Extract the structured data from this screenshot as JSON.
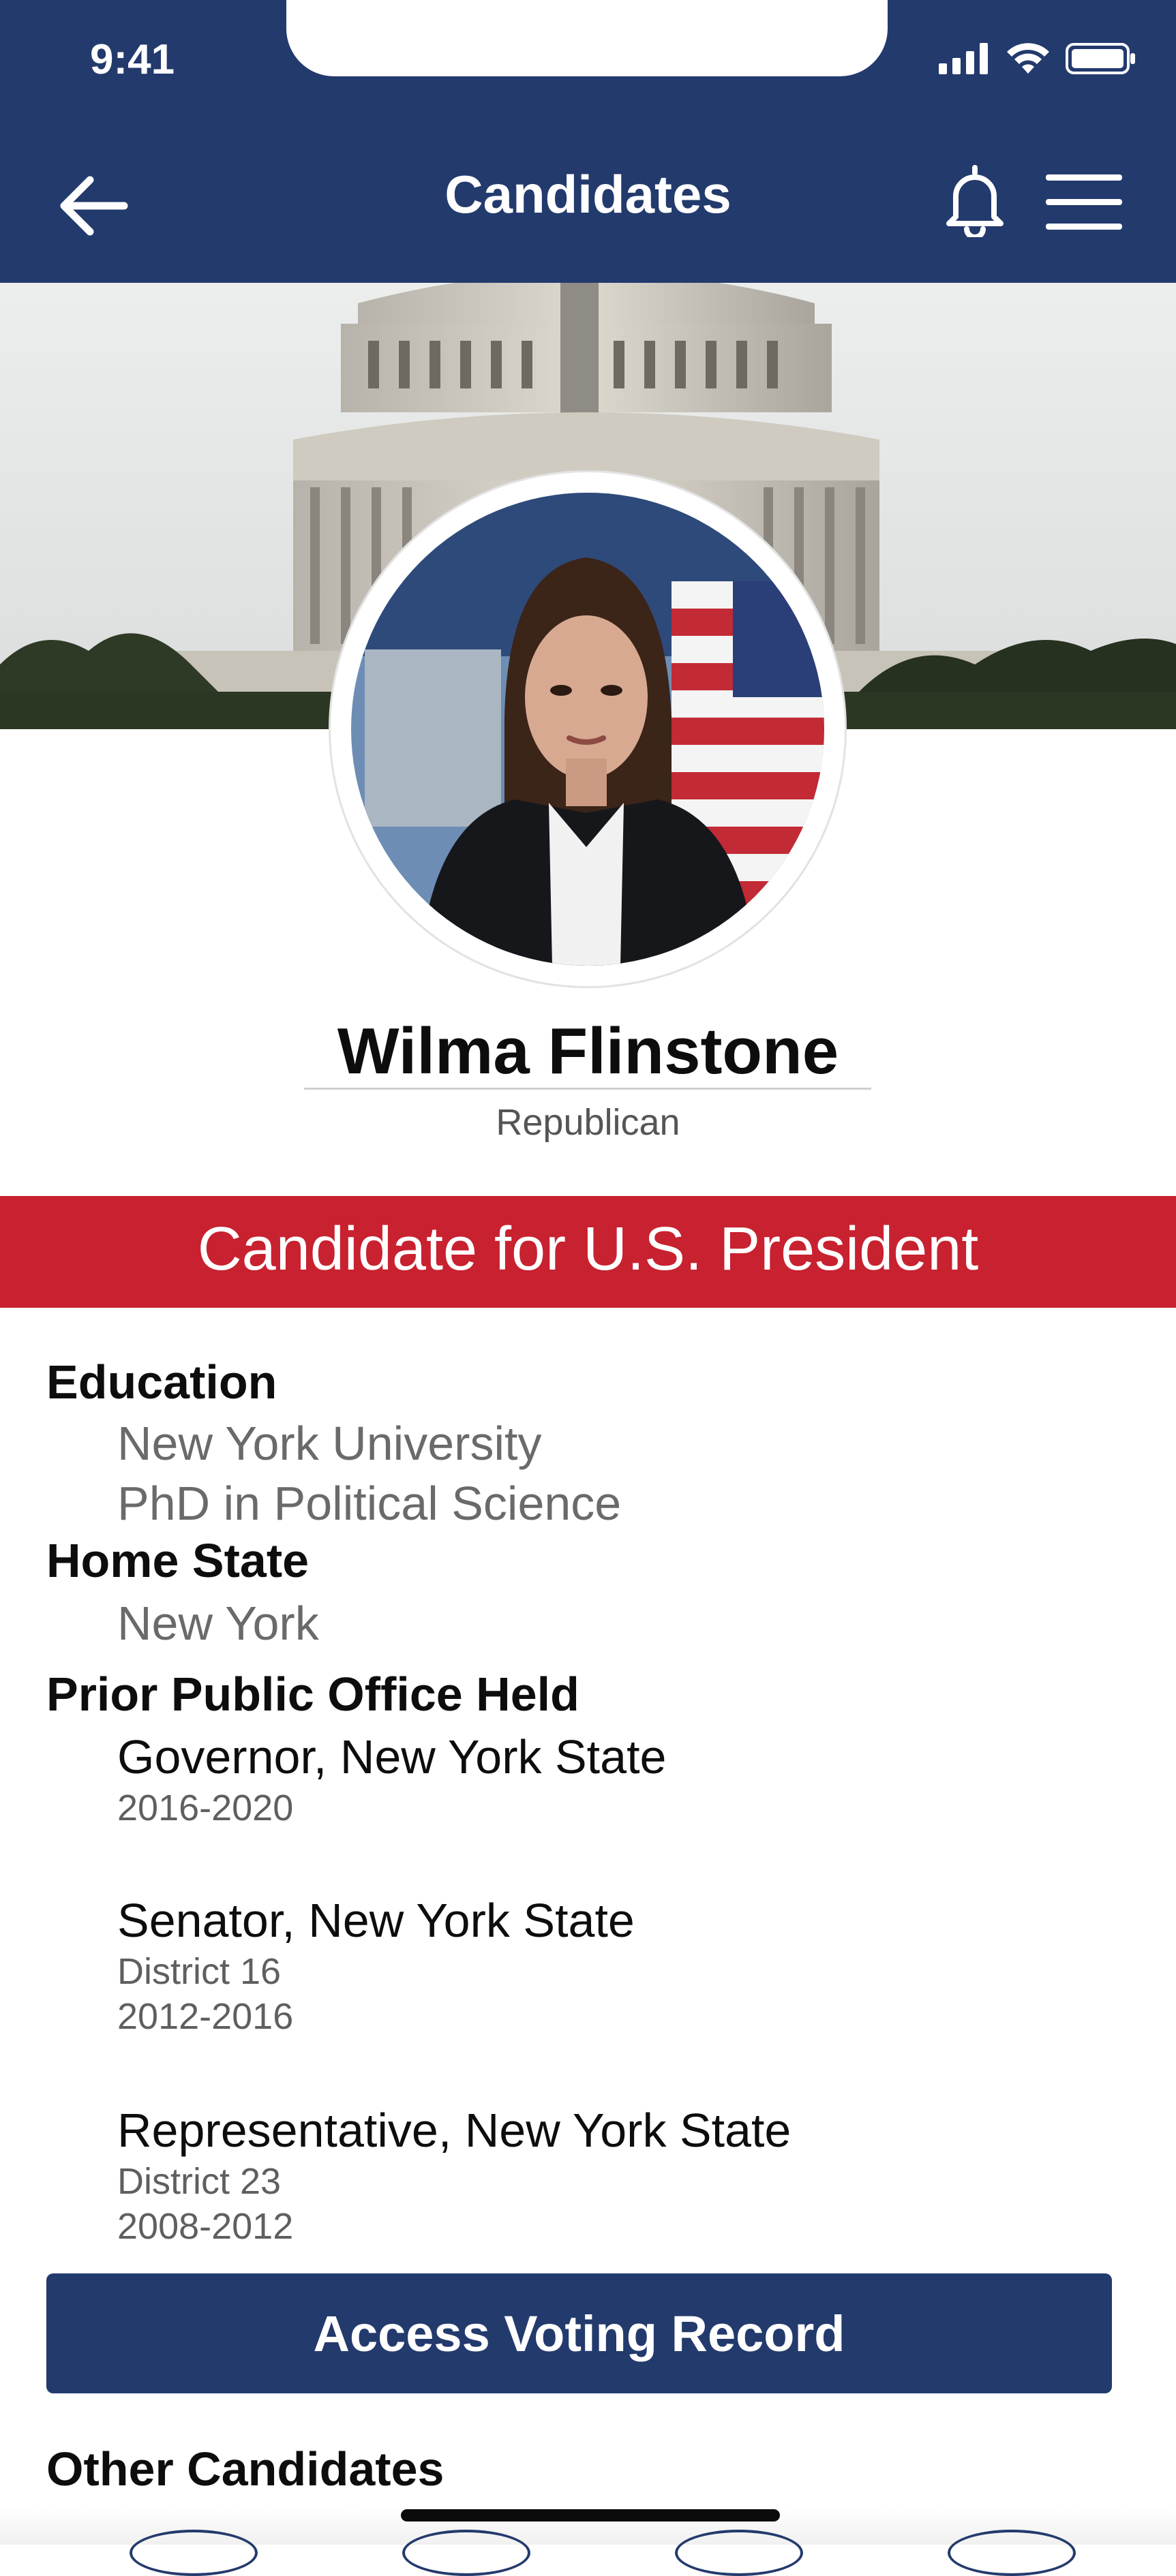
{
  "status_bar": {
    "time": "9:41",
    "icons": [
      "signal-icon",
      "wifi-icon",
      "battery-icon"
    ]
  },
  "header": {
    "title": "Candidates",
    "back_icon": "arrow-left-icon",
    "notification_icon": "bell-icon",
    "menu_icon": "hamburger-menu-icon"
  },
  "banner": {
    "image": "us-capitol-dome-photo"
  },
  "candidate": {
    "photo": "candidate-portrait-with-us-flag",
    "name": "Wilma Flinstone",
    "party": "Republican",
    "office": "Candidate for U.S. President"
  },
  "details": {
    "education": {
      "label": "Education",
      "school": "New York University",
      "degree": "PhD in Political Science"
    },
    "home_state": {
      "label": "Home State",
      "value": "New York"
    },
    "prior_office": {
      "label": "Prior Public Office Held",
      "entries": [
        {
          "title": "Governor, New York State",
          "lines": [
            "2016-2020"
          ]
        },
        {
          "title": "Senator, New York State",
          "lines": [
            "District 16",
            "2012-2016"
          ]
        },
        {
          "title": "Representative, New York State",
          "lines": [
            "District 23",
            "2008-2012"
          ]
        }
      ]
    }
  },
  "actions": {
    "voting_record_label": "Access Voting Record"
  },
  "other_candidates": {
    "label": "Other Candidates"
  },
  "colors": {
    "navy": "#233a6d",
    "red": "#c8212f",
    "white": "#ffffff"
  }
}
